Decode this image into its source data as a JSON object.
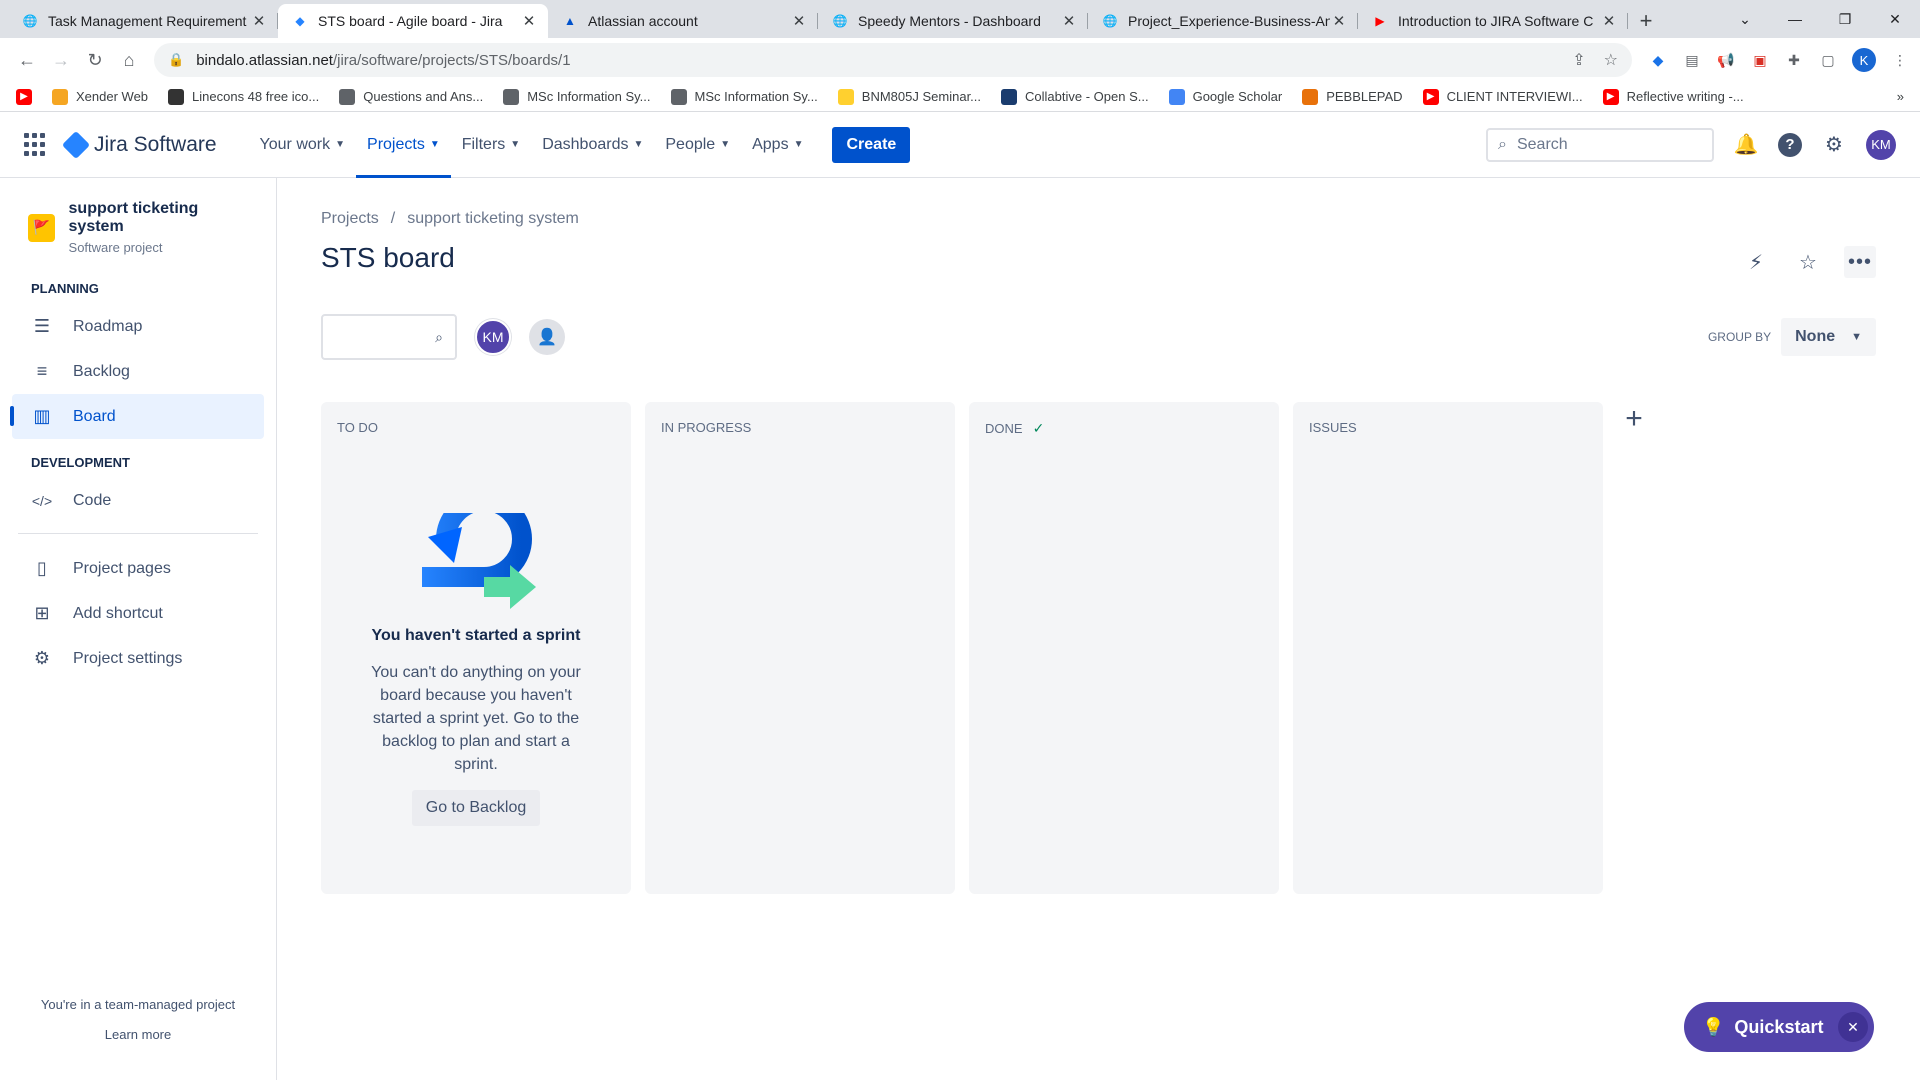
{
  "browser": {
    "tabs": [
      {
        "title": "Task Management Requirement",
        "favicon": "globe-icon"
      },
      {
        "title": "STS board - Agile board - Jira",
        "favicon": "jira-icon",
        "active": true
      },
      {
        "title": "Atlassian account",
        "favicon": "atlassian-icon"
      },
      {
        "title": "Speedy Mentors - Dashboard",
        "favicon": "globe-icon"
      },
      {
        "title": "Project_Experience-Business-An",
        "favicon": "globe-icon"
      },
      {
        "title": "Introduction to JIRA Software C",
        "favicon": "youtube-icon"
      }
    ],
    "url_host": "bindalo.atlassian.net",
    "url_path": "/jira/software/projects/STS/boards/1",
    "profile_initial": "K",
    "bookmarks": [
      {
        "label": "",
        "icon": "youtube-icon",
        "color": "#ff0000"
      },
      {
        "label": "Xender Web",
        "icon": "xender-icon",
        "color": "#f5a623"
      },
      {
        "label": "Linecons 48 free ico...",
        "icon": "linecons-icon",
        "color": "#333333"
      },
      {
        "label": "Questions and Ans...",
        "icon": "globe-icon",
        "color": "#5f6368"
      },
      {
        "label": "MSc Information Sy...",
        "icon": "globe-icon",
        "color": "#5f6368"
      },
      {
        "label": "MSc Information Sy...",
        "icon": "globe-icon",
        "color": "#5f6368"
      },
      {
        "label": "BNM805J Seminar...",
        "icon": "miro-icon",
        "color": "#ffd02f"
      },
      {
        "label": "Collabtive - Open S...",
        "icon": "collabtive-icon",
        "color": "#1a3c6e"
      },
      {
        "label": "Google Scholar",
        "icon": "scholar-icon",
        "color": "#4285f4"
      },
      {
        "label": "PEBBLEPAD",
        "icon": "pebblepad-icon",
        "color": "#e8710a"
      },
      {
        "label": "CLIENT INTERVIEWI...",
        "icon": "youtube-icon",
        "color": "#ff0000"
      },
      {
        "label": "Reflective writing -...",
        "icon": "youtube-icon",
        "color": "#ff0000"
      }
    ]
  },
  "jira": {
    "logo_text": "Jira Software",
    "nav": [
      {
        "label": "Your work"
      },
      {
        "label": "Projects",
        "active": true
      },
      {
        "label": "Filters"
      },
      {
        "label": "Dashboards"
      },
      {
        "label": "People"
      },
      {
        "label": "Apps"
      }
    ],
    "create_label": "Create",
    "search_placeholder": "Search",
    "avatar_initials": "KM"
  },
  "sidebar": {
    "project_name": "support ticketing system",
    "project_type": "Software project",
    "planning_label": "PLANNING",
    "development_label": "DEVELOPMENT",
    "planning_items": [
      {
        "label": "Roadmap",
        "icon": "roadmap-icon"
      },
      {
        "label": "Backlog",
        "icon": "backlog-icon"
      },
      {
        "label": "Board",
        "icon": "board-icon",
        "active": true
      }
    ],
    "dev_items": [
      {
        "label": "Code",
        "icon": "code-icon"
      }
    ],
    "other_items": [
      {
        "label": "Project pages",
        "icon": "page-icon"
      },
      {
        "label": "Add shortcut",
        "icon": "add-shortcut-icon"
      },
      {
        "label": "Project settings",
        "icon": "gear-icon"
      }
    ],
    "footer_text": "You're in a team-managed project",
    "learn_more": "Learn more"
  },
  "board": {
    "breadcrumb_root": "Projects",
    "breadcrumb_sep": "/",
    "breadcrumb_project": "support ticketing system",
    "title": "STS board",
    "member_initials": "KM",
    "group_by_label": "GROUP BY",
    "group_by_value": "None",
    "columns": [
      {
        "name": "TO DO"
      },
      {
        "name": "IN PROGRESS"
      },
      {
        "name": "DONE",
        "done": true
      },
      {
        "name": "ISSUES"
      }
    ],
    "empty_title": "You haven't started a sprint",
    "empty_text": "You can't do anything on your board because you haven't started a sprint yet. Go to the backlog to plan and start a sprint.",
    "go_backlog": "Go to Backlog"
  },
  "quickstart": {
    "label": "Quickstart"
  }
}
